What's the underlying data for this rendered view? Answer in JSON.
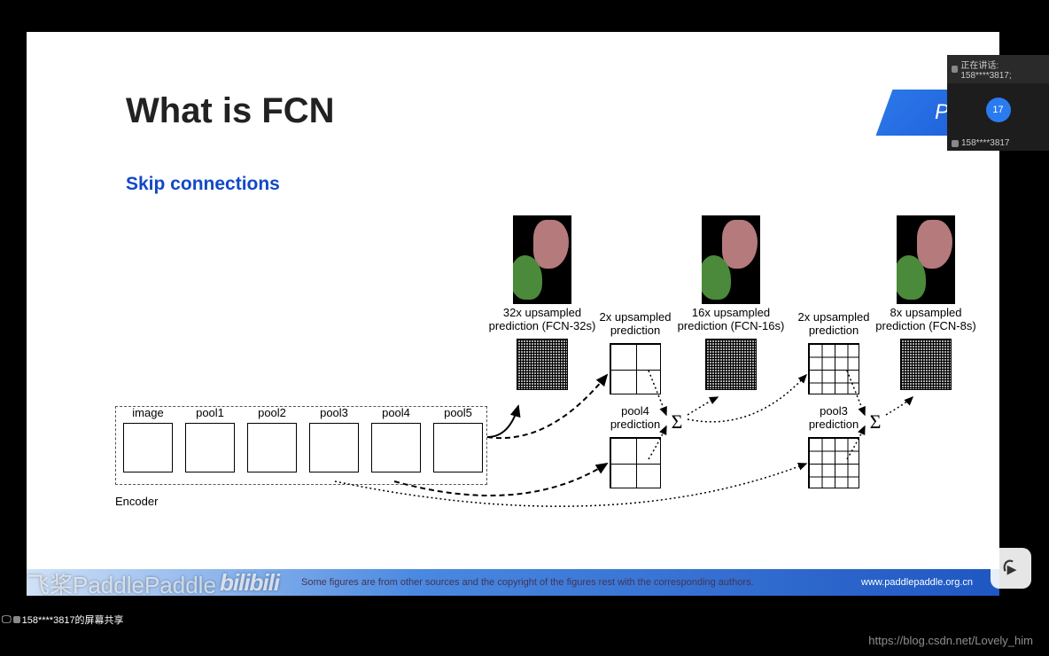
{
  "slide": {
    "title": "What is FCN",
    "subtitle": "Skip connections",
    "footer_text": "Some figures are from other sources and the copyright of the figures rest with the corresponding authors.",
    "footer_url": "www.paddlepaddle.org.cn",
    "logo_text": "P"
  },
  "diagram": {
    "encoder_label": "Encoder",
    "encoder_cols": [
      "image",
      "pool1",
      "pool2",
      "pool3",
      "pool4",
      "pool5"
    ],
    "outputs": [
      {
        "line1": "32x upsampled",
        "line2": "prediction (FCN-32s)"
      },
      {
        "line1": "2x upsampled",
        "line2": "prediction"
      },
      {
        "line1": "16x upsampled",
        "line2": "prediction (FCN-16s)"
      },
      {
        "line1": "2x upsampled",
        "line2": "prediction"
      },
      {
        "line1": "8x upsampled",
        "line2": "prediction (FCN-8s)"
      }
    ],
    "skip_labels": {
      "p4": "pool4\nprediction",
      "p3": "pool3\nprediction"
    }
  },
  "pip": {
    "top_text": "正在讲话: 158****3817;",
    "circle": "17",
    "bottom_text": "158****3817"
  },
  "presenter_bar": "158****3817的屏幕共享",
  "watermark": {
    "left": "飞桨PaddlePaddle",
    "bili": "bilibili",
    "bottom": "https://blog.csdn.net/Lovely_him"
  }
}
